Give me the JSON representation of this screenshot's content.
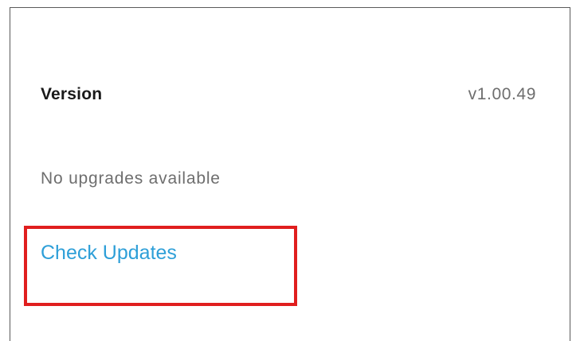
{
  "about": {
    "version_label": "Version",
    "version_value": "v1.00.49",
    "status_text": "No upgrades available",
    "check_updates_label": "Check Updates"
  },
  "colors": {
    "link": "#2e9fd8",
    "highlight": "#e01e1e",
    "secondary_text": "#6e6e6e"
  }
}
